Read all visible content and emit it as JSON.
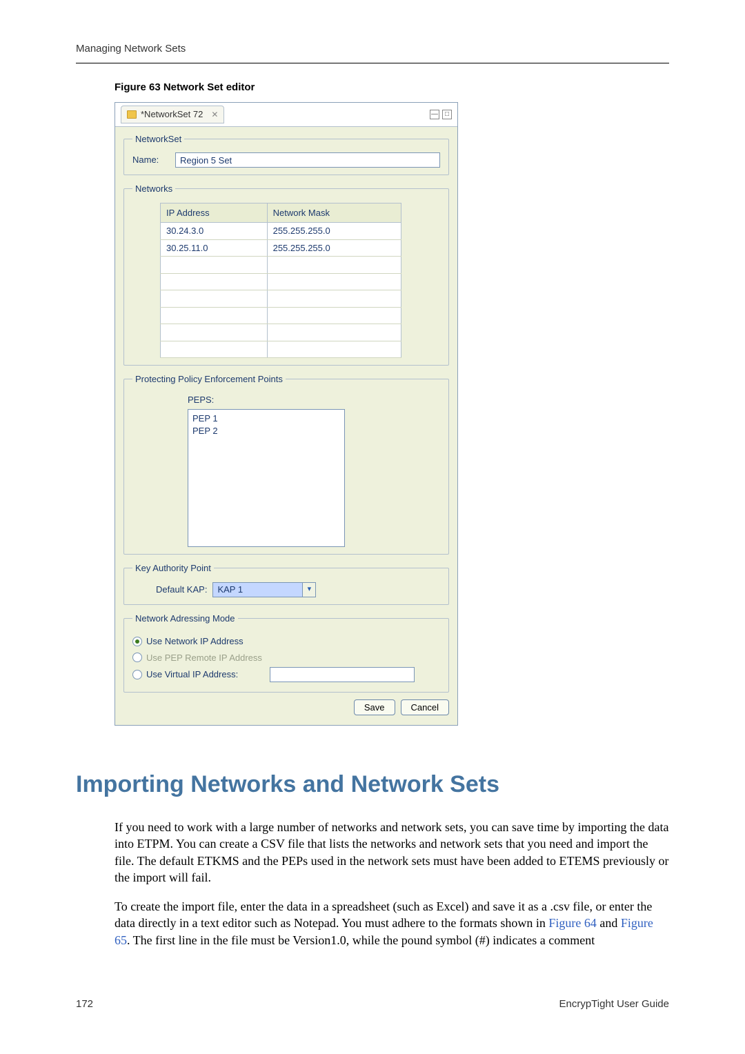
{
  "page_header": "Managing Network Sets",
  "figure_caption": "Figure 63    Network Set editor",
  "editor": {
    "tab_title": "*NetworkSet 72",
    "fieldset_networkset": "NetworkSet",
    "name_label": "Name:",
    "name_value": "Region 5 Set",
    "fieldset_networks": "Networks",
    "table_headers": {
      "ip": "IP Address",
      "mask": "Network Mask"
    },
    "table_rows": [
      {
        "ip": "30.24.3.0",
        "mask": "255.255.255.0"
      },
      {
        "ip": "30.25.11.0",
        "mask": "255.255.255.0"
      }
    ],
    "fieldset_peps": "Protecting Policy Enforcement Points",
    "peps_label": "PEPS:",
    "peps_items": [
      "PEP 1",
      "PEP 2"
    ],
    "fieldset_kap": "Key Authority Point",
    "kap_label": "Default KAP:",
    "kap_value": "KAP 1",
    "fieldset_mode": "Network Adressing Mode",
    "mode_use_network": "Use Network IP Address",
    "mode_use_pep": "Use PEP Remote IP Address",
    "mode_use_virtual": "Use Virtual IP Address:",
    "save_label": "Save",
    "cancel_label": "Cancel"
  },
  "section_heading": "Importing Networks and Network Sets",
  "para1": "If you need to work with a large number of networks and network sets, you can save time by importing the data into ETPM. You can create a CSV file that lists the networks and network sets that you need and import the file. The default ETKMS and the PEPs used in the network sets must have been added to ETEMS previously or the import will fail.",
  "para2_a": "To create the import file, enter the data in a spreadsheet (such as Excel) and save it as a .csv file, or enter the data directly in a text editor such as Notepad. You must adhere to the formats shown in ",
  "para2_link1": "Figure 64",
  "para2_b": " and ",
  "para2_link2": "Figure 65",
  "para2_c": ". The first line in the file must be Version1.0, while the pound symbol (#) indicates a comment",
  "footer_page": "172",
  "footer_doc": "EncrypTight User Guide"
}
